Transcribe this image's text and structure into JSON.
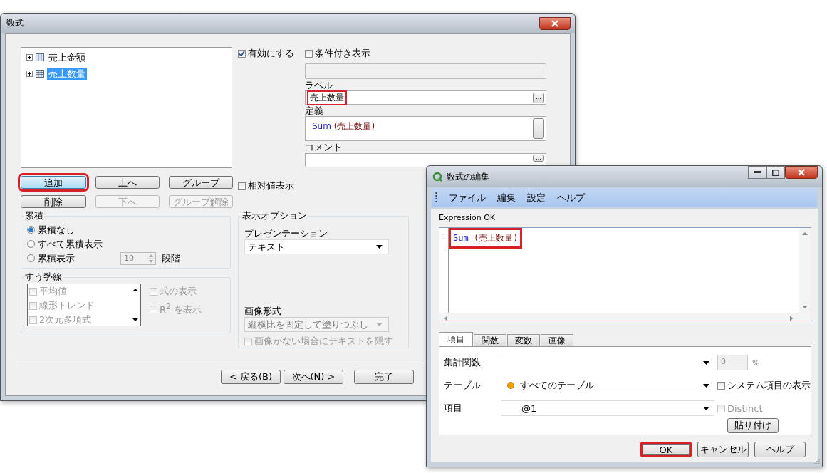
{
  "main_window": {
    "title": "数式",
    "expressions": [
      {
        "label": "売上金額",
        "selected": false,
        "expanded": false
      },
      {
        "label": "売上数量",
        "selected": true,
        "expanded": false
      }
    ],
    "list_buttons": [
      {
        "label": "追加",
        "disabled": false,
        "highlighted": true
      },
      {
        "label": "上へ",
        "disabled": false,
        "highlighted": false
      },
      {
        "label": "グループ",
        "disabled": false,
        "highlighted": false
      },
      {
        "label": "削除",
        "disabled": false,
        "highlighted": false
      },
      {
        "label": "下へ",
        "disabled": true,
        "highlighted": false
      },
      {
        "label": "グループ解除",
        "disabled": true,
        "highlighted": false
      }
    ],
    "enable": {
      "label": "有効にする",
      "checked": true
    },
    "relative": {
      "label": "相対値表示",
      "checked": false
    },
    "conditional": {
      "label": "条件付き表示",
      "checked": false
    },
    "label_field": {
      "caption": "ラベル",
      "value": "売上数量",
      "highlighted": true,
      "button": "..."
    },
    "definition": {
      "caption": "定義",
      "function": "Sum",
      "argument": "(売上数量)",
      "button": "..."
    },
    "comment": {
      "caption": "コメント",
      "button": "..."
    },
    "accumulation": {
      "title": "累積",
      "options": [
        {
          "label": "累積なし",
          "selected": true
        },
        {
          "label": "すべて累積表示",
          "selected": false
        },
        {
          "label": "累積表示",
          "selected": false
        }
      ],
      "steps_value": "10",
      "steps_unit": "段階"
    },
    "trendlines": {
      "title": "すう勢線",
      "disabled": true,
      "items": [
        {
          "label": "平均値",
          "checked": false
        },
        {
          "label": "線形トレンド",
          "checked": false
        },
        {
          "label": "2次元多項式",
          "checked": false
        }
      ],
      "options": [
        {
          "label": "式の表示",
          "checked": false
        },
        {
          "label": "R$^{2}$ を表示",
          "checked": false
        }
      ]
    },
    "display_options": {
      "title": "表示オプション",
      "presentation_caption": "プレゼンテーション",
      "presentation": "テキスト",
      "image_caption": "画像形式",
      "image_format": "縦横比を固定して塗りつぶし",
      "image_format_disabled": true,
      "hide_text": {
        "label": "画像がない場合にテキストを隠す",
        "checked": false,
        "disabled": true
      }
    },
    "nav_buttons": [
      "< 戻る(B)",
      "次へ(N) >",
      "完了"
    ]
  },
  "editor_window": {
    "title": "数式の編集",
    "menu": [
      "ファイル",
      "編集",
      "設定",
      "ヘルプ"
    ],
    "status": "Expression OK",
    "line_number": "1",
    "code_function": "Sum",
    "code_argument": "(売上数量)",
    "code_highlighted": true,
    "tabs": [
      {
        "label": "項目",
        "selected": true
      },
      {
        "label": "関数",
        "selected": false
      },
      {
        "label": "変数",
        "selected": false
      },
      {
        "label": "画像",
        "selected": false
      }
    ],
    "aggregate": {
      "caption": "集計関数",
      "percent_value": "0",
      "percent_unit": "%"
    },
    "table": {
      "caption": "テーブル",
      "value": "すべてのテーブル"
    },
    "field": {
      "caption": "項目",
      "value": "@1"
    },
    "system_fields": {
      "label": "システム項目の表示",
      "checked": false,
      "disabled": false
    },
    "distinct": {
      "label": "Distinct",
      "checked": false,
      "disabled": true
    },
    "paste_button": "貼り付け",
    "buttons": [
      {
        "label": "OK",
        "highlighted": true
      },
      {
        "label": "キャンセル",
        "highlighted": false
      },
      {
        "label": "ヘルプ",
        "highlighted": false
      }
    ]
  }
}
